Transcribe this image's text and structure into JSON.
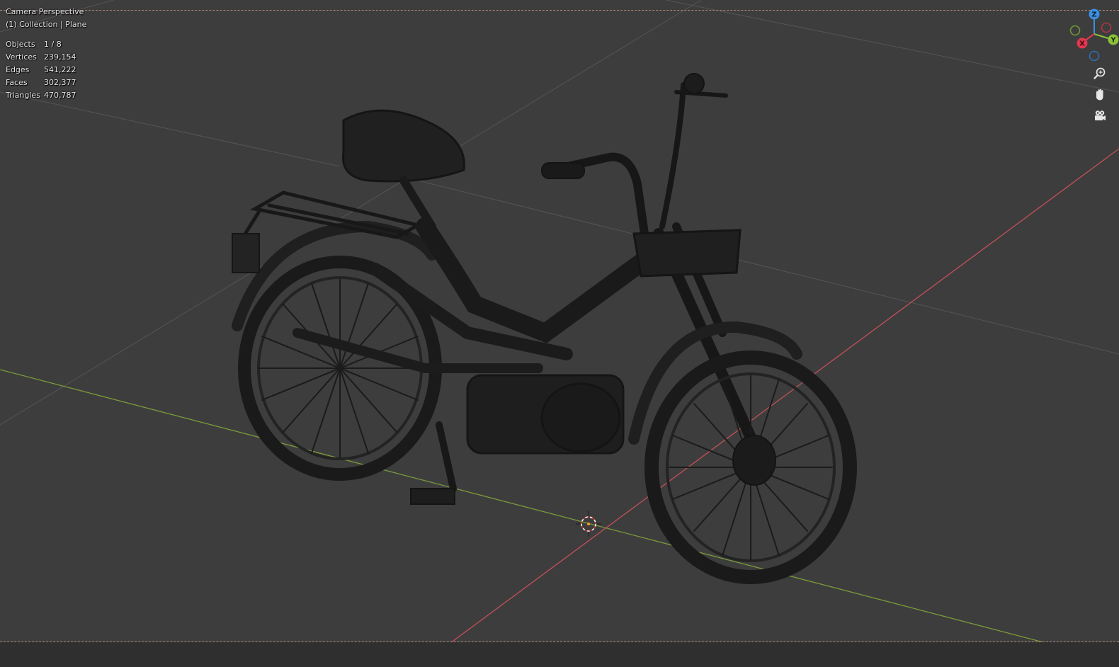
{
  "viewport": {
    "view_name": "Camera Perspective",
    "collection_label": "(1) Collection | Plane",
    "stats": [
      {
        "label": "Objects",
        "value": "1 / 8"
      },
      {
        "label": "Vertices",
        "value": "239,154"
      },
      {
        "label": "Edges",
        "value": "541,222"
      },
      {
        "label": "Faces",
        "value": "302,377"
      },
      {
        "label": "Triangles",
        "value": "470,787"
      }
    ]
  },
  "gizmo": {
    "z_label": "Z",
    "y_label": "Y",
    "x_label": "X",
    "colors": {
      "x": "#e2384f",
      "y": "#8bc23a",
      "z": "#3b8fe0"
    }
  },
  "nav": {
    "zoom_icon": "zoom-icon",
    "pan_icon": "hand-icon",
    "camera_icon": "camera-icon"
  },
  "colors": {
    "background": "#3d3d3d",
    "x_axis": "#c4505a",
    "y_axis": "#7a9a3a",
    "grid": "#555555",
    "wire": "#1a1a1a"
  }
}
